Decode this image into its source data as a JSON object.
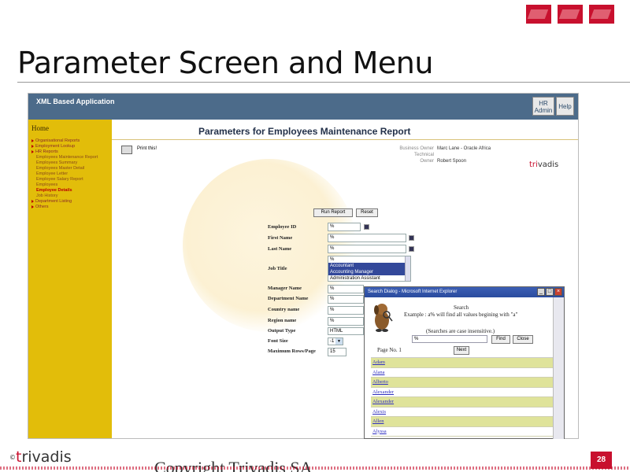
{
  "slide": {
    "title": "Parameter Screen and Menu",
    "footer_brand": "trivadis",
    "footer_copyright": "Copyright Trivadis SA",
    "page_number": "28",
    "copyright_symbol": "©"
  },
  "app": {
    "name": "XML Based Application",
    "hr_admin": "HR Admin",
    "help": "Help"
  },
  "sidebar": {
    "home": "Home",
    "items": [
      {
        "label": "Organisational Reports",
        "level": 1
      },
      {
        "label": "Employment Lookup",
        "level": 1
      },
      {
        "label": "HR Reports",
        "level": 1
      },
      {
        "label": "Employees Maintenance Report",
        "level": 2
      },
      {
        "label": "Employees Summary",
        "level": 2
      },
      {
        "label": "Employees Master Detail",
        "level": 2
      },
      {
        "label": "Employee Letter",
        "level": 2
      },
      {
        "label": "Employee Salary Report",
        "level": 2
      },
      {
        "label": "Employees",
        "level": 2
      },
      {
        "label": "Employee Details",
        "level": 2,
        "selected": true
      },
      {
        "label": "Job History",
        "level": 2
      },
      {
        "label": "Department Listing",
        "level": 1
      },
      {
        "label": "Others",
        "level": 1
      }
    ]
  },
  "main": {
    "heading": "Parameters for Employees Maintenance Report",
    "print_label": "Print this!",
    "owner_business_label": "Business Owner",
    "owner_business_value": "Marc Lane - Oracle Africa",
    "owner_technical_label": "Technical Owner",
    "owner_technical_value": "Robert Spoon",
    "brand_t": "tri",
    "brand_rest": "vadis",
    "run_report": "Run Report",
    "reset": "Reset",
    "fields": {
      "employee_id": {
        "label": "Employee ID",
        "value": "%"
      },
      "first_name": {
        "label": "First Name",
        "value": "%"
      },
      "last_name": {
        "label": "Last Name",
        "value": "%"
      },
      "job_title": {
        "label": "Job Title",
        "options": [
          "%",
          "Accountant",
          "Accounting Manager",
          "Administration Assistant"
        ],
        "selected": [
          "Accountant",
          "Accounting Manager"
        ]
      },
      "manager_name": {
        "label": "Manager Name",
        "value": "%"
      },
      "department_name": {
        "label": "Department Name",
        "value": "%"
      },
      "country_name": {
        "label": "Country name",
        "value": "%"
      },
      "region_name": {
        "label": "Region name",
        "value": "%"
      },
      "output_type": {
        "label": "Output Type",
        "value": "HTML"
      },
      "font_size": {
        "label": "Font Size",
        "value": "-1"
      },
      "max_rows": {
        "label": "Maximum Rows/Page",
        "value": "15"
      }
    }
  },
  "dialog": {
    "title": "Search Dialog - Microsoft Internet Explorer",
    "heading": "Search",
    "example": "Example : a% will find all values begining with \"a\"",
    "note": "(Searches are case insensitive.)",
    "query": "%",
    "find": "Find",
    "close": "Close",
    "page_label": "Page No. 1",
    "next": "Next",
    "results": [
      "Adam",
      "Alana",
      "Alberto",
      "Alexander",
      "Alexander",
      "Alexis",
      "Allen",
      "Alyssa"
    ]
  },
  "colors": {
    "app_bar": "#4c6b8a",
    "sidebar": "#e2bd0a",
    "brand_red": "#c8102e",
    "result_highlight": "#dfe39a"
  }
}
